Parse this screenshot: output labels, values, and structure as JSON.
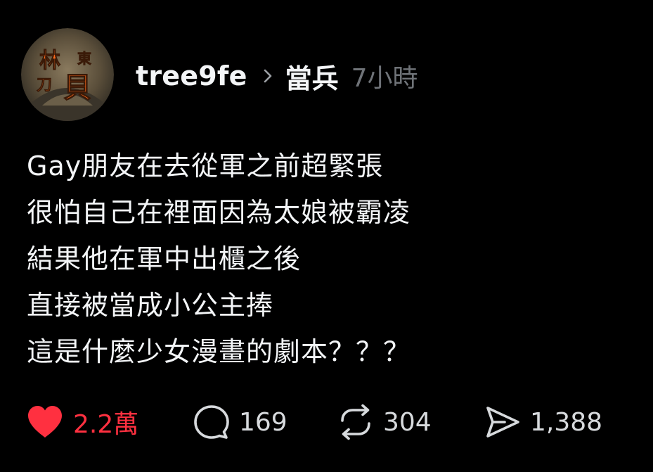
{
  "post": {
    "username": "tree9fe",
    "topic": "當兵",
    "time": "7小時",
    "avatar": {
      "text_top_left": "林",
      "text_small_left": "刀",
      "text_top_right": "東",
      "text_big_right": "貝"
    },
    "lines": [
      "Gay朋友在去從軍之前超緊張",
      "很怕自己在裡面因為太娘被霸凌",
      "結果他在軍中出櫃之後",
      "直接被當成小公主捧",
      "這是什麼少女漫畫的劇本？？？"
    ]
  },
  "actions": {
    "like": {
      "icon": "heart-icon",
      "count": "2.2萬",
      "liked": true
    },
    "reply": {
      "icon": "comment-icon",
      "count": "169"
    },
    "repost": {
      "icon": "repost-icon",
      "count": "304"
    },
    "share": {
      "icon": "send-icon",
      "count": "1,388"
    }
  },
  "colors": {
    "background": "#000000",
    "text": "#f3f5f7",
    "muted": "#6f7378",
    "like": "#ff3040",
    "avatar_text": "#ff6a1a"
  }
}
